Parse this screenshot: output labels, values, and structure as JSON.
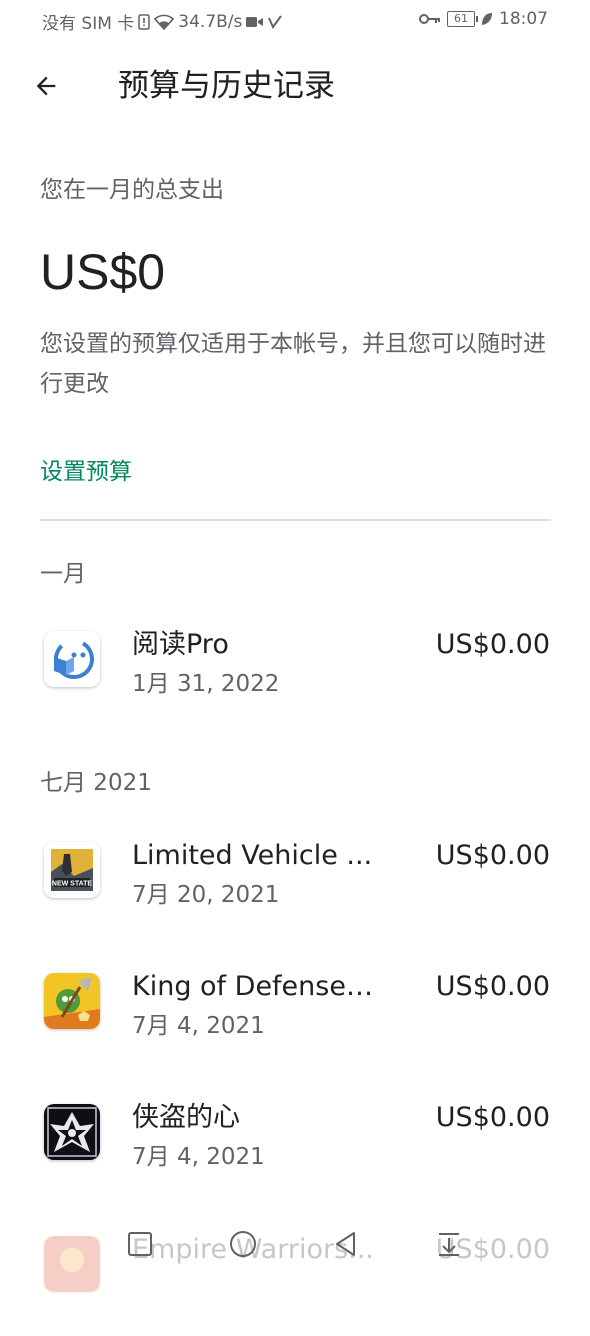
{
  "status_bar": {
    "carrier": "没有 SIM 卡",
    "speed": "34.7B/s",
    "battery": "61",
    "time": "18:07"
  },
  "app_bar": {
    "title": "预算与历史记录"
  },
  "summary": {
    "label": "您在一月的总支出",
    "total": "US$0",
    "note": "您设置的预算仅适用于本帐号，并且您可以随时进行更改",
    "set_budget_label": "设置预算"
  },
  "sections": [
    {
      "title": "一月",
      "items": [
        {
          "name": "阅读Pro",
          "date": "1月 31, 2022",
          "price": "US$0.00",
          "icon": "reader-app-icon"
        }
      ]
    },
    {
      "title": "七月 2021",
      "items": [
        {
          "name": "Limited Vehicle ...",
          "date": "7月 20, 2021",
          "price": "US$0.00",
          "icon": "new-state-game-icon"
        },
        {
          "name": "King of Defense ...",
          "date": "7月 4, 2021",
          "price": "US$0.00",
          "icon": "king-of-defense-game-icon"
        },
        {
          "name": "侠盗的心",
          "date": "7月 4, 2021",
          "price": "US$0.00",
          "icon": "thief-heart-game-icon"
        },
        {
          "name": "Empire Warriors...",
          "date": "",
          "price": "US$0.00",
          "icon": "empire-warriors-game-icon"
        }
      ]
    }
  ],
  "colors": {
    "accent": "#01875f",
    "text_primary": "#202124",
    "text_secondary": "#5f6368",
    "divider": "#dadce0"
  }
}
